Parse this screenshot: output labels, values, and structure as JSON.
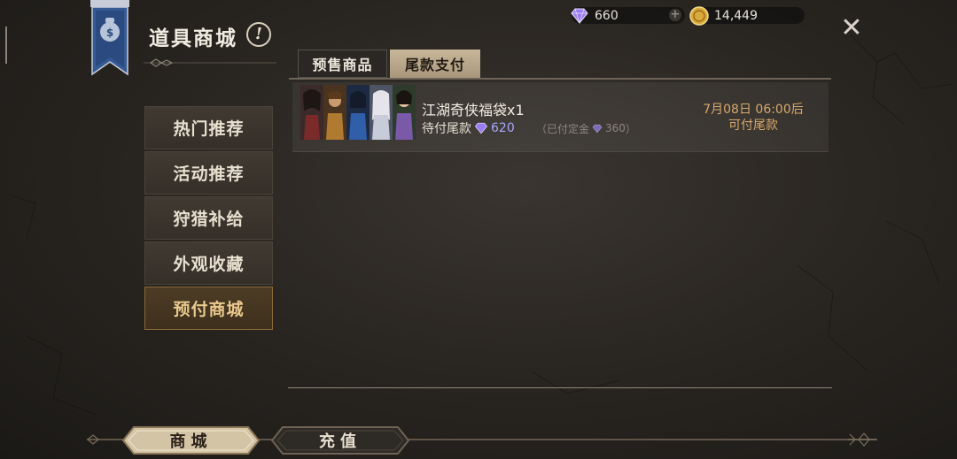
{
  "header": {
    "title": "道具商城",
    "info_glyph": "!"
  },
  "currency": {
    "gems": "660",
    "gold": "14,449",
    "gem_icon": "diamond-icon",
    "gold_icon": "gold-coin-icon"
  },
  "nav": {
    "items": [
      {
        "label": "热门推荐",
        "active": false
      },
      {
        "label": "活动推荐",
        "active": false
      },
      {
        "label": "狩猎补给",
        "active": false
      },
      {
        "label": "外观收藏",
        "active": false
      },
      {
        "label": "预付商城",
        "active": true
      }
    ]
  },
  "tabs": [
    {
      "label": "预售商品",
      "active": false
    },
    {
      "label": "尾款支付",
      "active": true
    }
  ],
  "product": {
    "name": "江湖奇侠福袋x1",
    "pending_label": "待付尾款",
    "pending_amount": "620",
    "deposit_open": "（已付定金",
    "deposit_amount": "360",
    "deposit_close": "）",
    "time_line1": "7月08日 06:00后",
    "time_line2": "可付尾款"
  },
  "bottom": {
    "shop_label": "商城",
    "recharge_label": "充值"
  },
  "colors": {
    "accent_gold": "#d8a96a",
    "gem_purple": "#a8a8ff",
    "active_tab": "#c9b79a"
  }
}
